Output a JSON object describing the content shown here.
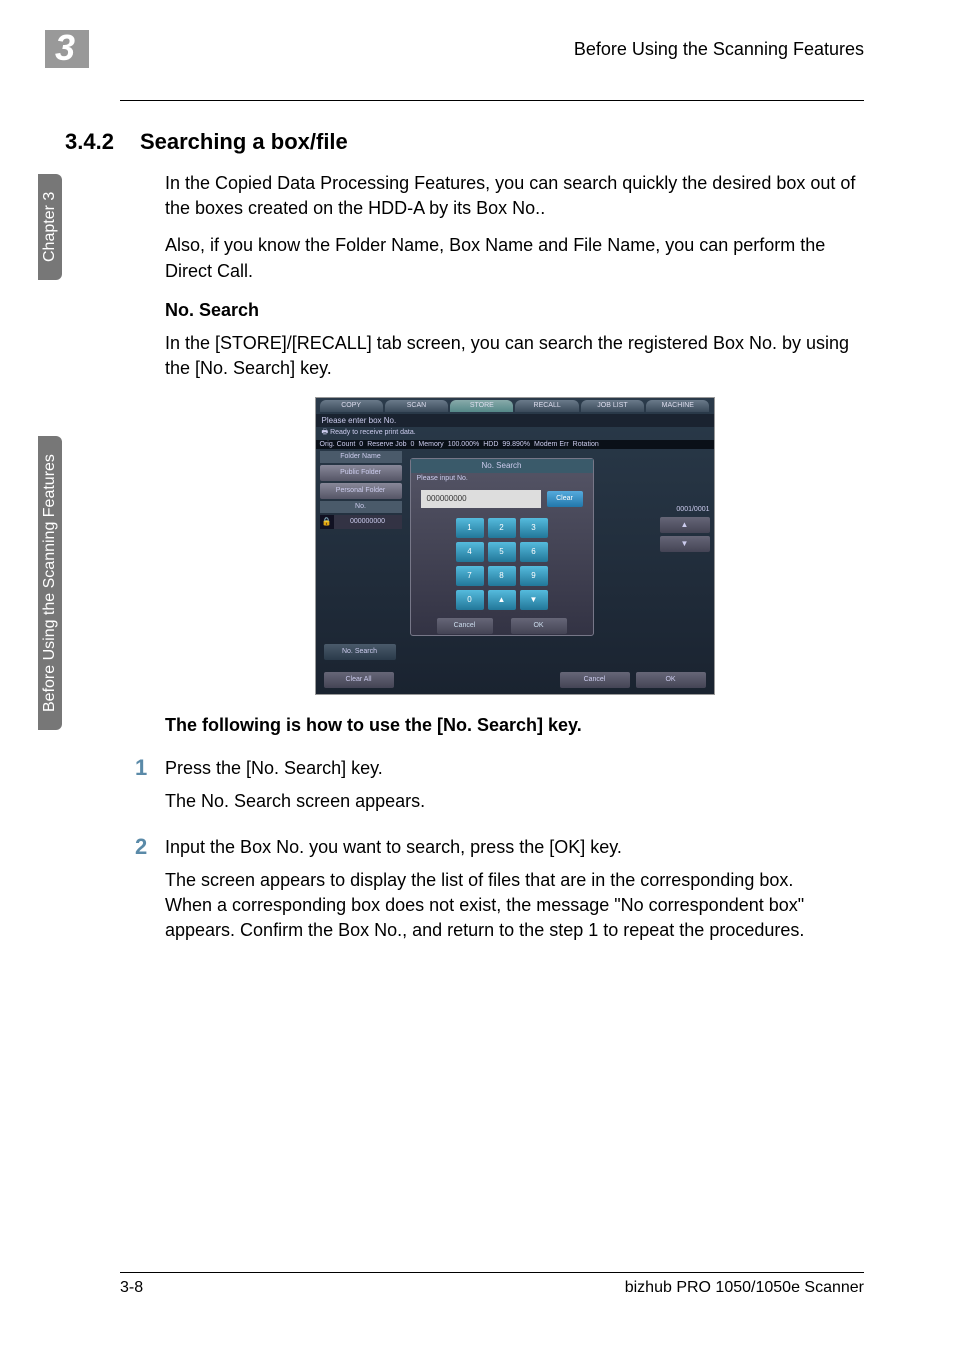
{
  "header": {
    "chapter_number": "3",
    "header_title": "Before Using the Scanning Features"
  },
  "section": {
    "number": "3.4.2",
    "title": "Searching a box/file"
  },
  "paragraphs": {
    "p1": "In the Copied Data Processing Features, you can search quickly the desired box out of the boxes created on the HDD-A by its Box No..",
    "p2": "Also, if you know the Folder Name, Box Name and File Name, you can perform the Direct Call.",
    "sub1_title": "No. Search",
    "p3": "In the [STORE]/[RECALL] tab screen, you can search the registered Box No. by using the [No. Search] key.",
    "sub2_title": "The following is how to use the [No. Search] key."
  },
  "steps": {
    "s1": {
      "num": "1",
      "text": "Press the [No. Search] key.",
      "subtext": "The No. Search screen appears."
    },
    "s2": {
      "num": "2",
      "text": "Input the Box No. you want to search, press the [OK] key.",
      "subtext": "The screen appears to display the list of files that are in the corresponding box.\nWhen a corresponding box does not exist, the message \"No correspondent box\" appears. Confirm the Box No., and return to the step 1 to repeat the procedures."
    }
  },
  "screenshot": {
    "tabs": {
      "copy": "COPY",
      "scan": "SCAN",
      "store": "STORE",
      "recall": "RECALL",
      "joblist": "JOB LIST",
      "machine": "MACHINE"
    },
    "prompt": "Please enter box No.",
    "status": {
      "ready": "Ready to receive print data.",
      "orig_count_label": "Orig. Count",
      "orig_count": "0",
      "reserve_label": "Reserve Job",
      "reserve": "0",
      "memory_label": "Memory",
      "memory": "100.000%",
      "hdd_label": "HDD",
      "hdd": "99.890%",
      "modem": "Modem Err",
      "rotation": "Rotation"
    },
    "left": {
      "folder_name_header": "Folder Name",
      "public_folder": "Public Folder",
      "personal_folder": "Personal Folder",
      "no_label": "No.",
      "no_value": "000000000",
      "lock_icon": "🔒"
    },
    "dialog": {
      "title": "No. Search",
      "prompt": "Please input No.",
      "input_value": "000000000",
      "clear": "Clear",
      "keys": {
        "k1": "1",
        "k2": "2",
        "k3": "3",
        "k4": "4",
        "k5": "5",
        "k6": "6",
        "k7": "7",
        "k8": "8",
        "k9": "9",
        "k0": "0",
        "kup": "▲",
        "kdown": "▼"
      },
      "cancel": "Cancel",
      "ok": "OK"
    },
    "right": {
      "counter": "0001/0001",
      "up": "▲",
      "down": "▼"
    },
    "no_search_btn": "No. Search",
    "bottom": {
      "clear_all": "Clear All",
      "cancel": "Cancel",
      "ok": "OK"
    }
  },
  "side_tabs": {
    "tab1": "Chapter 3",
    "tab2": "Before Using the Scanning Features"
  },
  "footer": {
    "page": "3-8",
    "product": "bizhub PRO 1050/1050e Scanner"
  }
}
